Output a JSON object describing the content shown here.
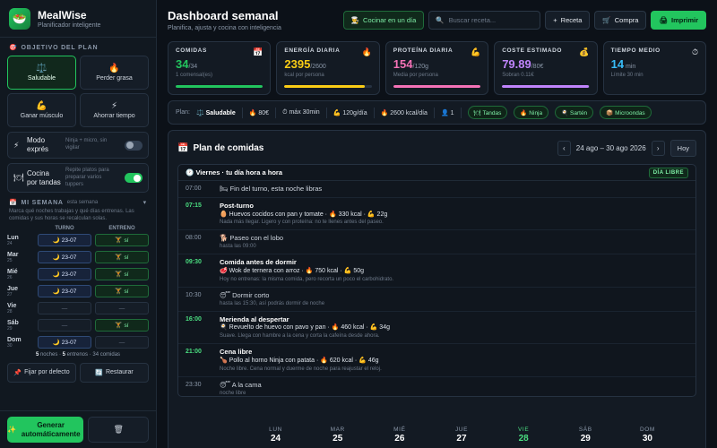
{
  "app": {
    "name": "MealWise",
    "tagline": "Planificador inteligente"
  },
  "sidebar": {
    "goal_label": "OBJETIVO DEL PLAN",
    "goals": [
      {
        "label": "Saludable",
        "icon": "⚖️",
        "active": true
      },
      {
        "label": "Perder grasa",
        "icon": "🔥",
        "active": false
      },
      {
        "label": "Ganar músculo",
        "icon": "💪",
        "active": false
      },
      {
        "label": "Ahorrar tiempo",
        "icon": "⚡",
        "active": false
      }
    ],
    "toggles": [
      {
        "icon": "⚡",
        "label": "Modo exprés",
        "desc": "Ninja + micro, sin vigilar",
        "on": false
      },
      {
        "icon": "🍽",
        "label": "Cocina por tandas",
        "desc": "Repite platos para preparar varios tuppers",
        "on": true
      }
    ],
    "week_label": "MI SEMANA",
    "week_sub": "esta semana",
    "week_hint": "Marca qué noches trabajas y qué días entrenas. Las comidas y sus horas se recalculan solas.",
    "col_turno": "TURNO",
    "col_entreno": "ENTRENO",
    "days": [
      {
        "abbr": "Lun",
        "num": "24",
        "turno": "23-07",
        "entreno": "sí"
      },
      {
        "abbr": "Mar",
        "num": "25",
        "turno": "23-07",
        "entreno": "sí"
      },
      {
        "abbr": "Mié",
        "num": "26",
        "turno": "23-07",
        "entreno": "sí"
      },
      {
        "abbr": "Jue",
        "num": "27",
        "turno": "23-07",
        "entreno": "sí"
      },
      {
        "abbr": "Vie",
        "num": "28",
        "turno": "—",
        "entreno": "—"
      },
      {
        "abbr": "Sáb",
        "num": "29",
        "turno": "—",
        "entreno": "sí"
      },
      {
        "abbr": "Dom",
        "num": "30",
        "turno": "23-07",
        "entreno": "—"
      }
    ],
    "summary_nights": "5",
    "summary_nights_label": "noches ·",
    "summary_trainings": "5",
    "summary_trainings_label": "entrenos ·",
    "summary_meals": "34 comidas",
    "pin_label": "Fijar por defecto",
    "restore_label": "Restaurar",
    "generate_label": "Generar automáticamente"
  },
  "header": {
    "title": "Dashboard semanal",
    "subtitle": "Planifica, ajusta y cocina con inteligencia",
    "cook_label": "Cocinar en un día",
    "search_placeholder": "Buscar receta...",
    "recipe_label": "Receta",
    "shop_label": "Compra",
    "print_label": "Imprimir"
  },
  "stats": [
    {
      "label": "COMIDAS",
      "icon": "📅",
      "value": "34",
      "unit": "/34",
      "sub": "1 comensal(es)",
      "color": "#22c55e",
      "progress": 1.0
    },
    {
      "label": "ENERGÍA DIARIA",
      "icon": "🔥",
      "value": "2395",
      "unit": "/2600",
      "sub": "kcal por persona",
      "color": "#facc15",
      "progress": 0.92
    },
    {
      "label": "PROTEÍNA DIARIA",
      "icon": "💪",
      "value": "154",
      "unit": "/120g",
      "sub": "Media por persona",
      "color": "#f472b6",
      "progress": 1.0
    },
    {
      "label": "COSTE ESTIMADO",
      "icon": "💰",
      "value": "79.89",
      "unit": "/80€",
      "sub": "Sobran 0.11€",
      "color": "#c084fc",
      "progress": 0.99
    },
    {
      "label": "TIEMPO MEDIO",
      "icon": "⏱",
      "value": "14",
      "unit": " min",
      "sub": "Límite 30 min",
      "color": "#38bdf8",
      "progress": 0.47
    }
  ],
  "plan_summary": {
    "label": "Plan:",
    "goal_icon": "⚖️",
    "goal": "Saludable",
    "items": [
      "🔥 80€",
      "⏱ máx 30min",
      "💪 120g/día",
      "🔥 2600 kcal/día",
      "👤 1"
    ],
    "tags": [
      "🍽 Tandas",
      "🔥 Ninja",
      "🍳 Sartén",
      "📦 Microondas"
    ]
  },
  "panel": {
    "title": "Plan de comidas",
    "range": "24 ago – 30 ago 2026",
    "today_label": "Hoy",
    "day_title": "Viernes · tu día hora a hora",
    "day_badge": "DÍA LIBRE",
    "events": [
      {
        "time": "07:00",
        "highlight": false,
        "title": "🛏 Fin del turno, esta noche libras",
        "muted": true,
        "line": "",
        "note": ""
      },
      {
        "time": "07:15",
        "highlight": true,
        "title": "Post-turno",
        "muted": false,
        "line": "🥚 Huevos cocidos con pan y tomate · 🔥 330 kcal · 💪 22g",
        "note": "Nada más llegar. Ligero y con proteína: no te llenes antes del paseo."
      },
      {
        "time": "08:00",
        "highlight": false,
        "title": "🐕 Paseo con el lobo",
        "muted": true,
        "line": "",
        "note": "hasta las 09:00"
      },
      {
        "time": "09:30",
        "highlight": true,
        "title": "Comida antes de dormir",
        "muted": false,
        "line": "🥩 Wok de ternera con arroz · 🔥 750 kcal · 💪 50g",
        "note": "Hoy no entrenas: la misma comida, pero recorta un poco el carbohidrato."
      },
      {
        "time": "10:30",
        "highlight": false,
        "title": "😴 Dormir corto",
        "muted": true,
        "line": "",
        "note": "hasta las 15:30, así podrás dormir de noche"
      },
      {
        "time": "16:00",
        "highlight": true,
        "title": "Merienda al despertar",
        "muted": false,
        "line": "🍳 Revuelto de huevo con pavo y pan · 🔥 460 kcal · 💪 34g",
        "note": "Suave. Llega con hambre a la cena y corta la cafeína desde ahora."
      },
      {
        "time": "21:00",
        "highlight": true,
        "title": "Cena libre",
        "muted": false,
        "line": "🍗 Pollo al horno Ninja con patata · 🔥 620 kcal · 💪 46g",
        "note": "Noche libre. Cena normal y duerme de noche para reajustar el reloj."
      },
      {
        "time": "23:30",
        "highlight": false,
        "title": "😴 A la cama",
        "muted": true,
        "line": "",
        "note": "noche libre"
      }
    ],
    "week": [
      {
        "d": "LUN",
        "n": "24",
        "today": false
      },
      {
        "d": "MAR",
        "n": "25",
        "today": false
      },
      {
        "d": "MIÉ",
        "n": "26",
        "today": false
      },
      {
        "d": "JUE",
        "n": "27",
        "today": false
      },
      {
        "d": "VIE",
        "n": "28",
        "today": true
      },
      {
        "d": "SÁB",
        "n": "29",
        "today": false
      },
      {
        "d": "DOM",
        "n": "30",
        "today": false
      }
    ]
  }
}
